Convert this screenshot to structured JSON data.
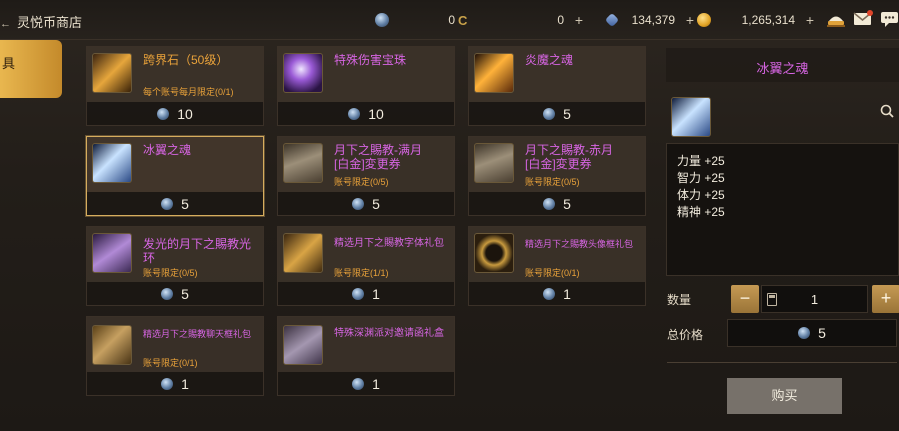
{
  "header": {
    "back_label": "灵悦币商店",
    "currencies": [
      {
        "icon": "gem-icon",
        "value": "0",
        "plus": ""
      },
      {
        "icon": "c-coin-icon",
        "value": "0",
        "plus": "+"
      },
      {
        "icon": "crystal-icon",
        "value": "134,379",
        "plus": "+"
      },
      {
        "icon": "gold-coin-icon",
        "value": "1,265,314",
        "plus": "+"
      }
    ]
  },
  "sidebar": {
    "active_tab": "具"
  },
  "items": [
    {
      "name": "跨界石（50级）",
      "limit": "每个账号每月限定(0/1)",
      "price": "10",
      "icon": "stone-icon"
    },
    {
      "name": "特殊伤害宝珠",
      "limit": "",
      "price": "10",
      "icon": "orb-icon"
    },
    {
      "name": "炎魔之魂",
      "limit": "",
      "price": "5",
      "icon": "flame-soul-icon"
    },
    {
      "name": "冰翼之魂",
      "limit": "",
      "price": "5",
      "icon": "ice-wing-icon"
    },
    {
      "name": "月下之賜教-满月\n[白金]変更券",
      "limit": "账号限定(0/5)",
      "price": "5",
      "icon": "ticket-icon"
    },
    {
      "name": "月下之賜教-赤月\n[白金]変更券",
      "limit": "账号限定(0/5)",
      "price": "5",
      "icon": "ticket-icon"
    },
    {
      "name": "发光的月下之賜教光环",
      "limit": "账号限定(0/5)",
      "price": "5",
      "icon": "gift-box-icon"
    },
    {
      "name": "精选月下之賜教字体礼包",
      "limit": "账号限定(1/1)",
      "price": "1",
      "icon": "scroll-icon"
    },
    {
      "name": "精选月下之賜教头像框礼包",
      "limit": "账号限定(0/1)",
      "price": "1",
      "icon": "ring-frame-icon"
    },
    {
      "name": "精选月下之賜教聊天框礼包",
      "limit": "账号限定(0/1)",
      "price": "1",
      "icon": "chat-frame-icon"
    },
    {
      "name": "特殊深渊派对邀请函礼盒",
      "limit": "",
      "price": "1",
      "icon": "chest-icon"
    }
  ],
  "detail": {
    "title": "冰翼之魂",
    "stats": [
      "力量 +25",
      "智力 +25",
      "体力 +25",
      "精神 +25"
    ],
    "quantity_label": "数量",
    "minus": "−",
    "plus": "+",
    "quantity": "1",
    "total_label": "总价格",
    "total": "5",
    "buy_label": "购买"
  },
  "colors": {
    "epic_name": "#d765e3",
    "limit_text": "#e9a23a",
    "accent_gold": "#c59a54",
    "selected_border": "#d6ad5e"
  }
}
